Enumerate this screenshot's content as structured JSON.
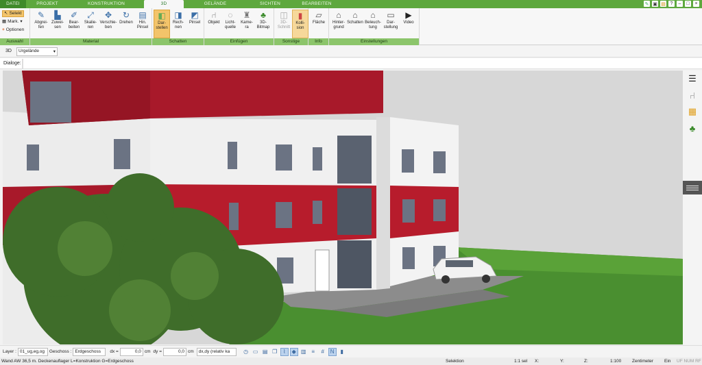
{
  "tabs": [
    "DATEI",
    "PROJEKT",
    "KONSTRUKTION",
    "3D",
    "GELÄNDE",
    "SICHTEN",
    "BEARBEITEN"
  ],
  "ribbon": {
    "auswahl": {
      "caption": "Auswahl",
      "selekt": "Selekt",
      "mark": "Mark.",
      "optionen": "Optionen"
    },
    "material": {
      "caption": "Material",
      "buttons": [
        "Abgrei-\nfen",
        "Zuwei-\nsen",
        "Bear-\nbeiten",
        "Skalie-\nren",
        "Verschie-\nben",
        "Drehen",
        "Hin.\nPinsel"
      ]
    },
    "schatten": {
      "caption": "Schatten",
      "buttons": [
        "Dar-\nstellen",
        "Rech-\nnen",
        "Pinsel"
      ]
    },
    "einfuegen": {
      "caption": "Einfügen",
      "buttons": [
        "Objekt",
        "Licht-\nquelle",
        "Kame-\nra",
        "3D-\nBitmap"
      ]
    },
    "sonstige": {
      "caption": "Sonstige",
      "buttons": [
        "3D-\nSchnitt",
        "Kolli-\nsion"
      ]
    },
    "info": {
      "caption": "Info",
      "buttons": [
        "Fläche"
      ]
    },
    "einstellungen": {
      "caption": "Einstellungen",
      "buttons": [
        "Hinter-\ngrund",
        "Schatten",
        "Beleuch-\ntung",
        "Dar-\nstellung",
        "Video"
      ]
    }
  },
  "viewbar": {
    "mode": "3D",
    "view": "Urgelände"
  },
  "dialoge_label": "Dialoge:",
  "bottom": {
    "layer_label": "Layer :",
    "layer_value": "01_ug,eg,og",
    "geschoss_label": "Geschoss :",
    "geschoss_value": "Erdgeschoss",
    "dx_label": "dx =",
    "dx_value": "0,0",
    "dx_unit": "cm",
    "dy_label": "dy =",
    "dy_value": "0,0",
    "dy_unit": "cm",
    "mode_value": "dx,dy (relativ ka"
  },
  "status": {
    "message": "Wand AW 36,5 m. Deckenauflager L=Konstruktion G=Erdgeschoss",
    "mode": "Selektion",
    "sel": "1:1 sel",
    "x": "X:",
    "y": "Y:",
    "z": "Z:",
    "scale": "1:100",
    "unit": "Zentimeter",
    "ein": "Ein",
    "flags": "UF NUM RF"
  },
  "colors": {
    "accent_green": "#5ea83e",
    "caption_green": "#8cc56b",
    "facade_red": "#a8192a",
    "grass": "#3f8a2a"
  }
}
